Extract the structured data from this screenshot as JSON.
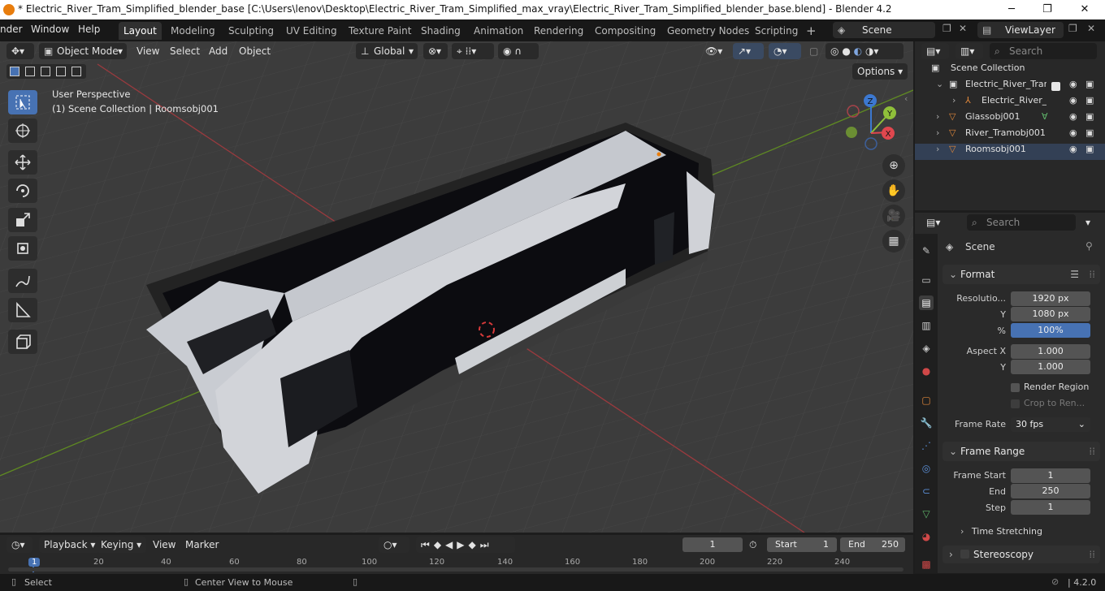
{
  "window": {
    "title": "* Electric_River_Tram_Simplified_blender_base [C:\\Users\\lenov\\Desktop\\Electric_River_Tram_Simplified_max_vray\\Electric_River_Tram_Simplified_blender_base.blend] - Blender 4.2",
    "minimize": "─",
    "maximize": "❐",
    "close": "✕"
  },
  "menu": {
    "items": [
      "nder",
      "Window",
      "Help"
    ],
    "workspaces": [
      "Layout",
      "Modeling",
      "Sculpting",
      "UV Editing",
      "Texture Paint",
      "Shading",
      "Animation",
      "Rendering",
      "Compositing",
      "Geometry Nodes",
      "Scripting"
    ],
    "active_workspace": "Layout",
    "add_tab": "+",
    "scene": "Scene",
    "view_layer": "ViewLayer"
  },
  "viewport": {
    "mode": "Object Mode",
    "menus": [
      "View",
      "Select",
      "Add",
      "Object"
    ],
    "transform_orientation": "Global",
    "options": "Options",
    "perspective": "User Perspective",
    "collection_info": "(1) Scene Collection | Roomsobj001",
    "gizmo": {
      "z": "Z",
      "y": "Y",
      "x": "X"
    }
  },
  "outliner": {
    "search_placeholder": "Search",
    "root": "Scene Collection",
    "rows": [
      {
        "label": "Electric_River_Tram",
        "icon": "collection-icon"
      },
      {
        "label": "Electric_River_T",
        "icon": "armature-icon"
      },
      {
        "label": "Glassobj001",
        "icon": "mesh-icon"
      },
      {
        "label": "River_Tramobj001",
        "icon": "mesh-icon"
      },
      {
        "label": "Roomsobj001",
        "icon": "mesh-icon"
      }
    ]
  },
  "properties": {
    "search_placeholder": "Search",
    "context": "Scene",
    "format": {
      "title": "Format",
      "resolution_label": "Resolutio...",
      "res_x": "1920 px",
      "y_label": "Y",
      "res_y": "1080 px",
      "pct_label": "%",
      "pct": "100%",
      "aspect_x_label": "Aspect X",
      "aspect_x": "1.000",
      "aspect_y_label": "Y",
      "aspect_y": "1.000",
      "render_region": "Render Region",
      "crop": "Crop to Ren...",
      "frame_rate_label": "Frame Rate",
      "frame_rate": "30 fps"
    },
    "frame_range": {
      "title": "Frame Range",
      "start_label": "Frame Start",
      "start": "1",
      "end_label": "End",
      "end": "250",
      "step_label": "Step",
      "step": "1"
    },
    "time_stretching": "Time Stretching",
    "stereoscopy": "Stereoscopy"
  },
  "timeline": {
    "menus": [
      "Playback",
      "Keying",
      "View",
      "Marker"
    ],
    "current_frame": "1",
    "start_label": "Start",
    "start": "1",
    "end_label": "End",
    "end": "250",
    "ticks": [
      "1",
      "20",
      "40",
      "60",
      "80",
      "100",
      "120",
      "140",
      "160",
      "180",
      "200",
      "220",
      "240"
    ],
    "current_frame_fraction": 0.0
  },
  "status": {
    "select": "Select",
    "center_view": "Center View to Mouse",
    "version": "4.2.0"
  },
  "colors": {
    "accent": "#4772b3",
    "active_object": "#e87d0d",
    "x_axis": "#e0474e",
    "y_axis": "#8fbf3a",
    "z_axis": "#3c78d0"
  }
}
